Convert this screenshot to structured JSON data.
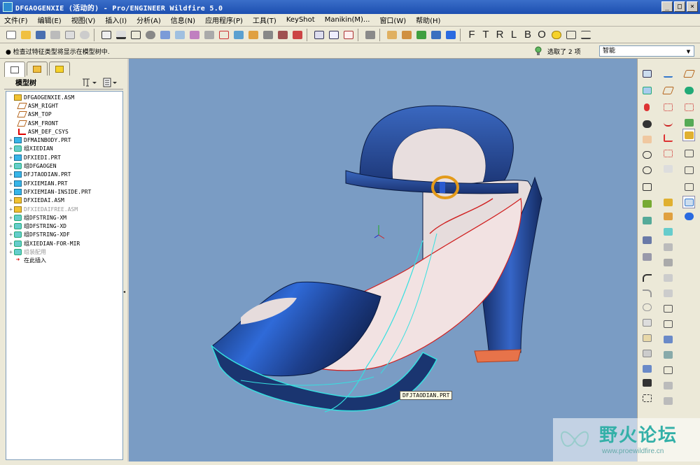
{
  "window": {
    "title": "DFGAOGENXIE (活动的) - Pro/ENGINEER Wildfire 5.0",
    "controls": [
      "_",
      "□",
      "×"
    ]
  },
  "menu": [
    "文件(F)",
    "编辑(E)",
    "视图(V)",
    "插入(I)",
    "分析(A)",
    "信息(N)",
    "应用程序(P)",
    "工具(T)",
    "KeyShot",
    "Manikin(M)...",
    "窗口(W)",
    "帮助(H)"
  ],
  "toolbar_letters": [
    "F",
    "T",
    "R",
    "L",
    "B",
    "O"
  ],
  "status": {
    "message": "● 检查过特征类型将显示在模型树中.",
    "selection_count": "选取了 2 项",
    "filter_value": "智能"
  },
  "model_tree": {
    "header": "模型树",
    "items": [
      {
        "label": "DFGAOGENXIE.ASM",
        "icon": "assembly-icon",
        "expand": ""
      },
      {
        "label": "ASM_RIGHT",
        "icon": "datum-plane-icon",
        "expand": ""
      },
      {
        "label": "ASM_TOP",
        "icon": "datum-plane-icon",
        "expand": ""
      },
      {
        "label": "ASM_FRONT",
        "icon": "datum-plane-icon",
        "expand": ""
      },
      {
        "label": "ASM_DEF_CSYS",
        "icon": "csys-icon",
        "expand": ""
      },
      {
        "label": "DFMAINBODY.PRT",
        "icon": "part-icon",
        "expand": "+"
      },
      {
        "label": "组XIEDIAN",
        "icon": "group-icon",
        "expand": "+"
      },
      {
        "label": "DFXIEDI.PRT",
        "icon": "part-icon",
        "expand": "+"
      },
      {
        "label": "组DFGAOGEN",
        "icon": "group-icon",
        "expand": "+"
      },
      {
        "label": "DFJTAODIAN.PRT",
        "icon": "part-icon",
        "expand": "+"
      },
      {
        "label": "DFXIEMIAN.PRT",
        "icon": "part-icon",
        "expand": "+"
      },
      {
        "label": "DFXIEMIAN-INSIDE.PRT",
        "icon": "part-icon",
        "expand": "+"
      },
      {
        "label": "DFXIEDAI.ASM",
        "icon": "assembly-icon",
        "expand": "+"
      },
      {
        "label": "DFXIEDAIFREE.ASM",
        "icon": "assembly-icon",
        "expand": "+",
        "dim": true
      },
      {
        "label": "组DFSTRING-XM",
        "icon": "group-icon",
        "expand": "+"
      },
      {
        "label": "组DFSTRING-XD",
        "icon": "group-icon",
        "expand": "+"
      },
      {
        "label": "组DFSTRING-XDF",
        "icon": "group-icon",
        "expand": "+"
      },
      {
        "label": "组XIEDIAN-FOR-MIR",
        "icon": "group-icon",
        "expand": "+"
      },
      {
        "label": "组装配用",
        "icon": "group-icon",
        "expand": "+",
        "dim": true
      },
      {
        "label": "在此插入",
        "icon": "insert-here-icon",
        "expand": ""
      }
    ]
  },
  "viewport": {
    "part_tooltip": "DFJTAODIAN.PRT",
    "background_color": "#7a9cc4",
    "shoe_color": "#1e3a78"
  },
  "watermark": {
    "text": "野火论坛",
    "url": "www.proewildfire.cn"
  }
}
